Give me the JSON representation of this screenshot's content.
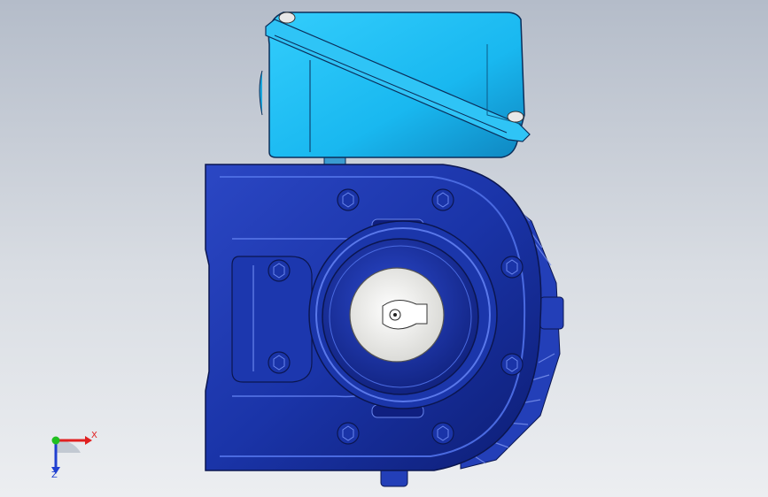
{
  "viewport": {
    "background_top": "#b4bcc9",
    "background_bottom": "#eceef1"
  },
  "model": {
    "parts": [
      "peristaltic-pump-housing",
      "electrical-junction-box",
      "rotor-hub",
      "drive-shaft"
    ],
    "colors": {
      "housing": "#1a34a8",
      "housing_dark": "#0d1d74",
      "housing_highlight": "#4a6ae0",
      "junction_box": "#19b8f0",
      "junction_box_dark": "#0f7fb8",
      "shaft": "#f4f4f2"
    }
  },
  "triad": {
    "x_label": "X",
    "z_label": "Z",
    "x_color": "#e02020",
    "z_color": "#2040d0",
    "y_color": "#20c020"
  }
}
